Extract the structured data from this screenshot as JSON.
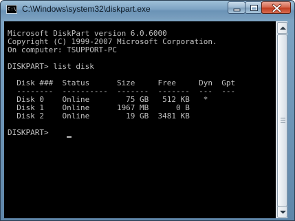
{
  "window": {
    "title": "C:\\Windows\\system32\\diskpart.exe",
    "icon_text": "C:\\"
  },
  "console": {
    "lines": [
      "Microsoft DiskPart version 6.0.6000",
      "Copyright (C) 1999-2007 Microsoft Corporation.",
      "On computer: TSUPPORT-PC",
      "",
      "DISKPART> list disk",
      "",
      "  Disk ###  Status      Size     Free     Dyn  Gpt",
      "  --------  ----------  -------  -------  ---  ---",
      "  Disk 0    Online        75 GB   512 KB   *",
      "  Disk 1    Online      1967 MB      0 B",
      "  Disk 2    Online        19 GB  3481 KB",
      "",
      "DISKPART> "
    ]
  },
  "colors": {
    "console_background": "#000000",
    "console_text": "#c0c0c0",
    "close_button": "#c94a2e"
  },
  "icons": {
    "app": "console-icon",
    "minimize": "minimize-icon",
    "maximize": "maximize-icon",
    "close": "close-icon",
    "scroll_up": "arrow-up-icon",
    "scroll_down": "arrow-down-icon"
  }
}
